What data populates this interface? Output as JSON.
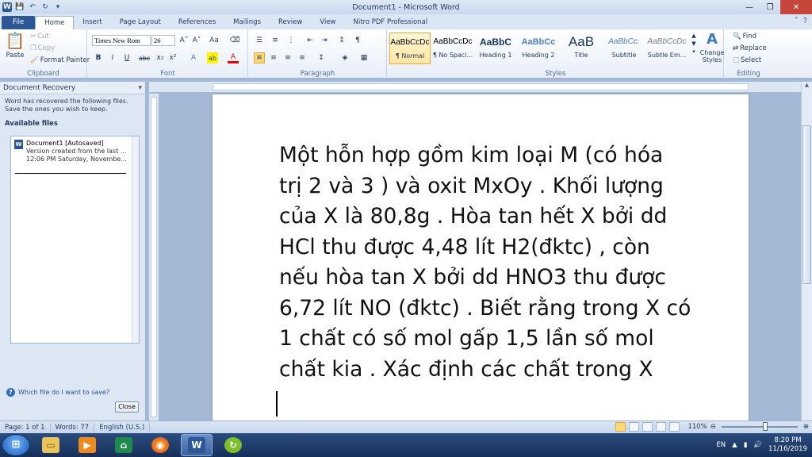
{
  "window": {
    "title": "Document1 - Microsoft Word",
    "controls": {
      "minimize": "—",
      "restore": "❐",
      "close": "✕"
    }
  },
  "qat": {
    "save": "💾",
    "undo": "↶",
    "redo": "↻",
    "more": "▾"
  },
  "tabs": {
    "file": "File",
    "items": [
      "Home",
      "Insert",
      "Page Layout",
      "References",
      "Mailings",
      "Review",
      "View",
      "Nitro PDF Professional"
    ],
    "active": "Home"
  },
  "ribbon": {
    "clipboard": {
      "label": "Clipboard",
      "paste": "Paste",
      "cut": "Cut",
      "copy": "Copy",
      "format_painter": "Format Painter"
    },
    "font": {
      "label": "Font",
      "font_name": "Times New Rom",
      "font_size": "26",
      "grow": "A˄",
      "shrink": "A˅",
      "change_case": "Aa",
      "bold": "B",
      "italic": "I",
      "underline": "U",
      "strike": "abc",
      "subscript": "x₂",
      "superscript": "x²",
      "effects": "A",
      "highlight": "ab",
      "color": "A"
    },
    "paragraph": {
      "label": "Paragraph"
    },
    "styles": {
      "label": "Styles",
      "items": [
        {
          "preview": "AaBbCcDc",
          "name": "¶ Normal"
        },
        {
          "preview": "AaBbCcDc",
          "name": "¶ No Spaci..."
        },
        {
          "preview": "AaBbC",
          "name": "Heading 1"
        },
        {
          "preview": "AaBbCc",
          "name": "Heading 2"
        },
        {
          "preview": "AaB",
          "name": "Title"
        },
        {
          "preview": "AaBbCc.",
          "name": "Subtitle"
        },
        {
          "preview": "AaBbCcDc",
          "name": "Subtle Em..."
        }
      ],
      "change_styles": "Change Styles"
    },
    "editing": {
      "label": "Editing",
      "find": "Find",
      "replace": "Replace",
      "select": "Select"
    }
  },
  "recovery": {
    "title": "Document Recovery",
    "message": "Word has recovered the following files.  Save the ones you wish to keep.",
    "available_label": "Available files",
    "file": {
      "name": "Document1  [Autosaved]",
      "line2": "Version created from the last ...",
      "line3": "12:06 PM Saturday, Novembe..."
    },
    "help_link": "Which file do I want to save?",
    "close": "Close"
  },
  "document": {
    "text": "Một hỗn hợp gồm kim loại M (có hóa trị 2 và 3 ) và oxit MxOy . Khối lượng của X là 80,8g . Hòa tan hết X bởi dd HCl thu được 4,48 lít H2(đktc) , còn nếu hòa tan X bởi dd HNO3 thu được 6,72 lít NO (đktc) . Biết rằng trong X có 1 chất có số mol gấp 1,5 lần số mol chất kia . Xác định các chất trong X"
  },
  "status": {
    "page": "Page: 1 of 1",
    "words": "Words: 77",
    "language": "English (U.S.)",
    "zoom": "110%"
  },
  "taskbar": {
    "language": "EN",
    "time": "8:20 PM",
    "date": "11/16/2019"
  }
}
